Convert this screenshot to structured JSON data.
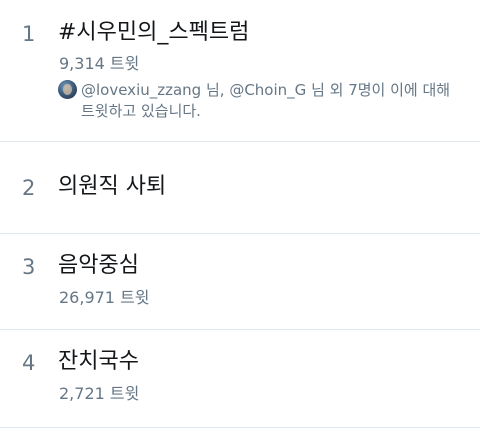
{
  "trends": [
    {
      "rank": "1",
      "name": "#시우민의_스펙트럼",
      "count": "9,314 트윗",
      "context": {
        "user1": "@lovexiu_zzang",
        "suffix1": " 님, ",
        "user2": "@Choin_G",
        "suffix2": " 님 외 7명이 이에 대해",
        "line2": "트윗하고 있습니다."
      }
    },
    {
      "rank": "2",
      "name": "의원직 사퇴"
    },
    {
      "rank": "3",
      "name": "음악중심",
      "count": "26,971 트윗"
    },
    {
      "rank": "4",
      "name": "잔치국수",
      "count": "2,721 트윗"
    }
  ],
  "icons": {
    "context_avatar": "avatar-image"
  },
  "colors": {
    "primary_text": "#14171a",
    "secondary_text": "#657786",
    "divider": "#e1e8ed",
    "background": "#ffffff"
  }
}
